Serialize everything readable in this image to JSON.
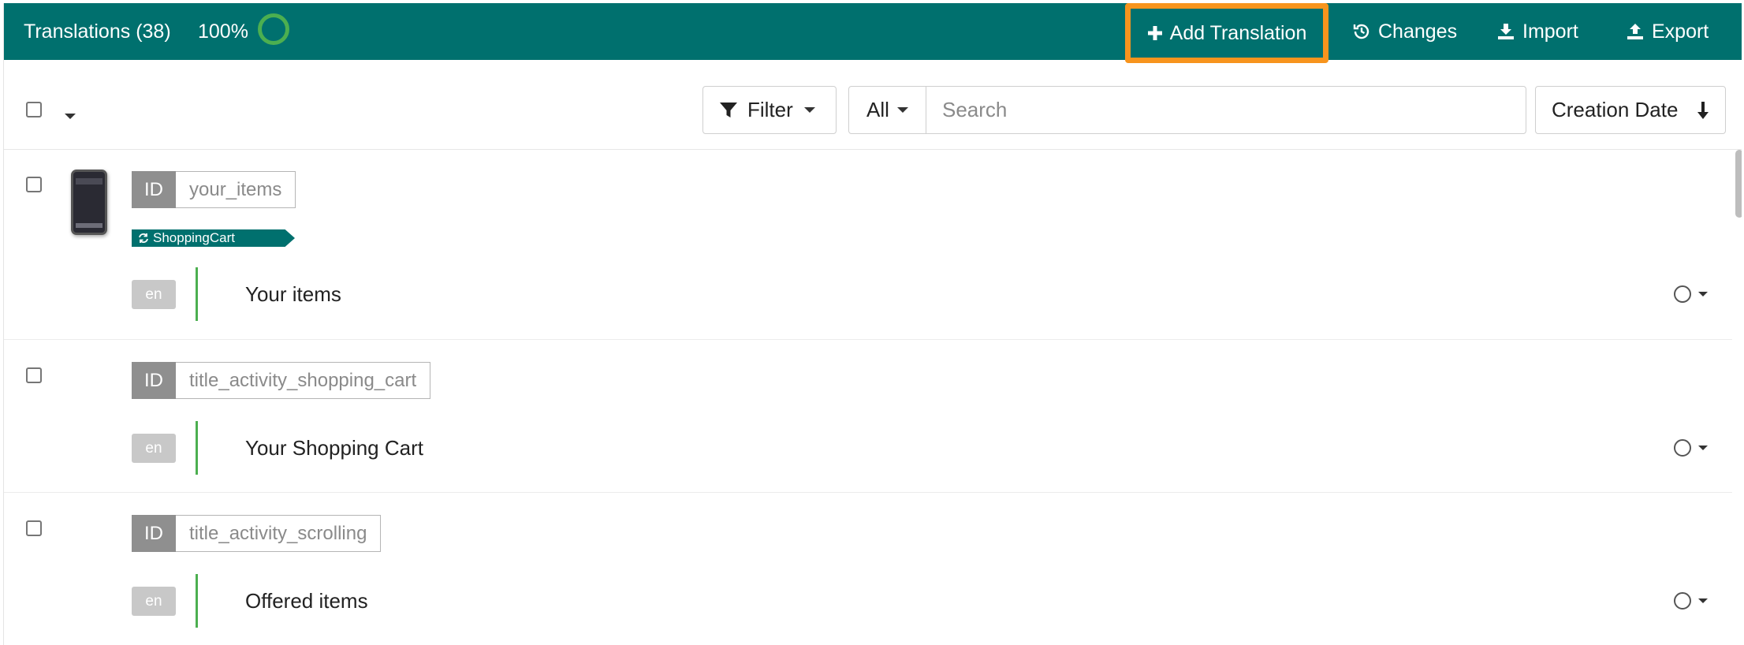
{
  "header": {
    "title": "Translations (38)",
    "progress": "100%",
    "actions": {
      "add": "Add Translation",
      "changes": "Changes",
      "import": "Import",
      "export": "Export"
    },
    "highlight_color": "#f7941d",
    "bar_color": "#00706e"
  },
  "toolbar": {
    "filter_label": "Filter",
    "scope_label": "All",
    "search_placeholder": "Search",
    "search_value": "",
    "sort_label": "Creation Date",
    "sort_icon": "arrow-down-icon"
  },
  "rows": [
    {
      "key_label": "ID",
      "key": "your_items",
      "tag": "ShoppingCart",
      "has_screenshot": true,
      "lang": "en",
      "text": "Your items"
    },
    {
      "key_label": "ID",
      "key": "title_activity_shopping_cart",
      "lang": "en",
      "text": "Your Shopping Cart"
    },
    {
      "key_label": "ID",
      "key": "title_activity_scrolling",
      "lang": "en",
      "text": "Offered items"
    }
  ]
}
